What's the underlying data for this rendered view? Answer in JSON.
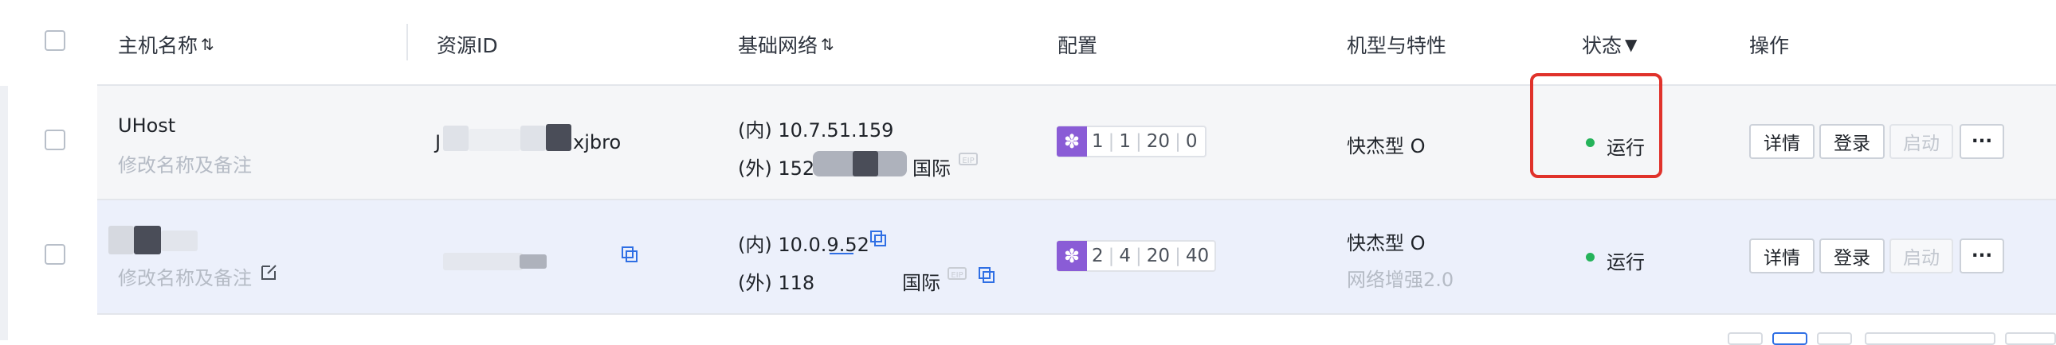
{
  "table": {
    "headers": {
      "host_name": "主机名称",
      "resource_id": "资源ID",
      "network": "基础网络",
      "config": "配置",
      "model": "机型与特性",
      "status": "状态",
      "actions": "操作"
    },
    "rows": [
      {
        "name": "UHost",
        "remark_link": "修改名称及备注",
        "resource_id_prefix": "J",
        "resource_id_suffix": "xjbro",
        "ip_inner": "(内) 10.7.51.159",
        "ip_outer_prefix": "(外) 152.",
        "region": "国际",
        "config": {
          "cpu": "1",
          "mem": "1",
          "disk": "20",
          "gpu": "0"
        },
        "model": "快杰型 O",
        "model_feature": "",
        "status": "运行",
        "actions": {
          "detail": "详情",
          "login": "登录",
          "start": "启动",
          "more": "···"
        }
      },
      {
        "name": "",
        "remark_link": "修改名称及备注",
        "resource_id_prefix": "",
        "resource_id_suffix": "",
        "ip_inner": "(内) 10.0.9.52",
        "ip_outer_prefix": "(外) 118",
        "region": "国际",
        "config": {
          "cpu": "2",
          "mem": "4",
          "disk": "20",
          "gpu": "40"
        },
        "model": "快杰型 O",
        "model_feature": "网络增强2.0",
        "status": "运行",
        "actions": {
          "detail": "详情",
          "login": "登录",
          "start": "启动",
          "more": "···"
        }
      }
    ]
  },
  "icons": {
    "sort": "sort-icon",
    "filter": "filter-icon",
    "copy": "copy-icon",
    "edit": "edit-icon",
    "eip": "eip-icon",
    "config": "gear-icon"
  },
  "colors": {
    "status_running": "#25b35a",
    "highlight": "#e0322b",
    "config_badge": "#8a5cd6",
    "link_blue": "#2f6fe4"
  }
}
